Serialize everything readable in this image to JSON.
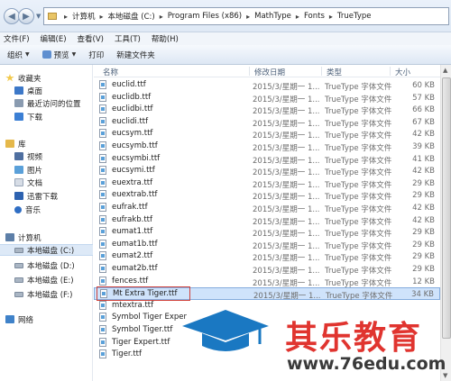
{
  "address": {
    "crumbs": [
      "计算机",
      "本地磁盘 (C:)",
      "Program Files (x86)",
      "MathType",
      "Fonts",
      "TrueType"
    ]
  },
  "menu": [
    "文件(F)",
    "编辑(E)",
    "查看(V)",
    "工具(T)",
    "帮助(H)"
  ],
  "toolbar": {
    "organize": "组织",
    "preview": "预览",
    "print": "打印",
    "new_folder": "新建文件夹"
  },
  "sidebar": {
    "items": [
      {
        "label": "收藏夹",
        "icon": "star-icon",
        "indent": 0
      },
      {
        "label": "桌面",
        "icon": "desktop-icon",
        "indent": 1
      },
      {
        "label": "最近访问的位置",
        "icon": "recent-places-icon",
        "indent": 1
      },
      {
        "label": "下载",
        "icon": "download-icon",
        "indent": 1
      },
      {
        "label": "库",
        "icon": "library-icon",
        "indent": 0
      },
      {
        "label": "视频",
        "icon": "video-icon",
        "indent": 1
      },
      {
        "label": "图片",
        "icon": "picture-icon",
        "indent": 1
      },
      {
        "label": "文档",
        "icon": "document-icon",
        "indent": 1
      },
      {
        "label": "迅雷下载",
        "icon": "thunder-download-icon",
        "indent": 1
      },
      {
        "label": "音乐",
        "icon": "music-icon",
        "indent": 1
      },
      {
        "label": "计算机",
        "icon": "computer-icon",
        "indent": 0
      },
      {
        "label": "本地磁盘 (C:)",
        "icon": "drive-icon",
        "indent": 1
      },
      {
        "label": "本地磁盘 (D:)",
        "icon": "drive-icon",
        "indent": 1
      },
      {
        "label": "本地磁盘 (E:)",
        "icon": "drive-icon",
        "indent": 1
      },
      {
        "label": "本地磁盘 (F:)",
        "icon": "drive-icon",
        "indent": 1
      },
      {
        "label": "网络",
        "icon": "network-icon",
        "indent": 0
      }
    ]
  },
  "columns": {
    "name": "名称",
    "date": "修改日期",
    "type": "类型",
    "size": "大小"
  },
  "files": [
    {
      "name": "euclid.ttf",
      "date": "2015/3/星期一 1...",
      "type": "TrueType 字体文件",
      "size": "60 KB"
    },
    {
      "name": "euclidb.ttf",
      "date": "2015/3/星期一 1...",
      "type": "TrueType 字体文件",
      "size": "57 KB"
    },
    {
      "name": "euclidbi.ttf",
      "date": "2015/3/星期一 1...",
      "type": "TrueType 字体文件",
      "size": "66 KB"
    },
    {
      "name": "euclidi.ttf",
      "date": "2015/3/星期一 1...",
      "type": "TrueType 字体文件",
      "size": "67 KB"
    },
    {
      "name": "eucsym.ttf",
      "date": "2015/3/星期一 1...",
      "type": "TrueType 字体文件",
      "size": "42 KB"
    },
    {
      "name": "eucsymb.ttf",
      "date": "2015/3/星期一 1...",
      "type": "TrueType 字体文件",
      "size": "39 KB"
    },
    {
      "name": "eucsymbi.ttf",
      "date": "2015/3/星期一 1...",
      "type": "TrueType 字体文件",
      "size": "41 KB"
    },
    {
      "name": "eucsymi.ttf",
      "date": "2015/3/星期一 1...",
      "type": "TrueType 字体文件",
      "size": "42 KB"
    },
    {
      "name": "euextra.ttf",
      "date": "2015/3/星期一 1...",
      "type": "TrueType 字体文件",
      "size": "29 KB"
    },
    {
      "name": "euextrab.ttf",
      "date": "2015/3/星期一 1...",
      "type": "TrueType 字体文件",
      "size": "29 KB"
    },
    {
      "name": "eufrak.ttf",
      "date": "2015/3/星期一 1...",
      "type": "TrueType 字体文件",
      "size": "42 KB"
    },
    {
      "name": "eufrakb.ttf",
      "date": "2015/3/星期一 1...",
      "type": "TrueType 字体文件",
      "size": "42 KB"
    },
    {
      "name": "eumat1.ttf",
      "date": "2015/3/星期一 1...",
      "type": "TrueType 字体文件",
      "size": "29 KB"
    },
    {
      "name": "eumat1b.ttf",
      "date": "2015/3/星期一 1...",
      "type": "TrueType 字体文件",
      "size": "29 KB"
    },
    {
      "name": "eumat2.ttf",
      "date": "2015/3/星期一 1...",
      "type": "TrueType 字体文件",
      "size": "29 KB"
    },
    {
      "name": "eumat2b.ttf",
      "date": "2015/3/星期一 1...",
      "type": "TrueType 字体文件",
      "size": "29 KB"
    },
    {
      "name": "fences.ttf",
      "date": "2015/3/星期一 1...",
      "type": "TrueType 字体文件",
      "size": "12 KB"
    },
    {
      "name": "Mt Extra Tiger.ttf",
      "date": "2015/3/星期一 1...",
      "type": "TrueType 字体文件",
      "size": "34 KB"
    },
    {
      "name": "mtextra.ttf",
      "date": "",
      "type": "",
      "size": ""
    },
    {
      "name": "Symbol Tiger Exper",
      "date": "",
      "type": "",
      "size": ""
    },
    {
      "name": "Symbol Tiger.ttf",
      "date": "",
      "type": "",
      "size": ""
    },
    {
      "name": "Tiger Expert.ttf",
      "date": "",
      "type": "",
      "size": ""
    },
    {
      "name": "Tiger.ttf",
      "date": "",
      "type": "",
      "size": ""
    }
  ],
  "selected_file_index": 17,
  "watermark": {
    "brand": "其乐教育",
    "url": "www.76edu.com",
    "colors": {
      "brand": "#e0342f",
      "cap": "#1a78c2"
    }
  }
}
